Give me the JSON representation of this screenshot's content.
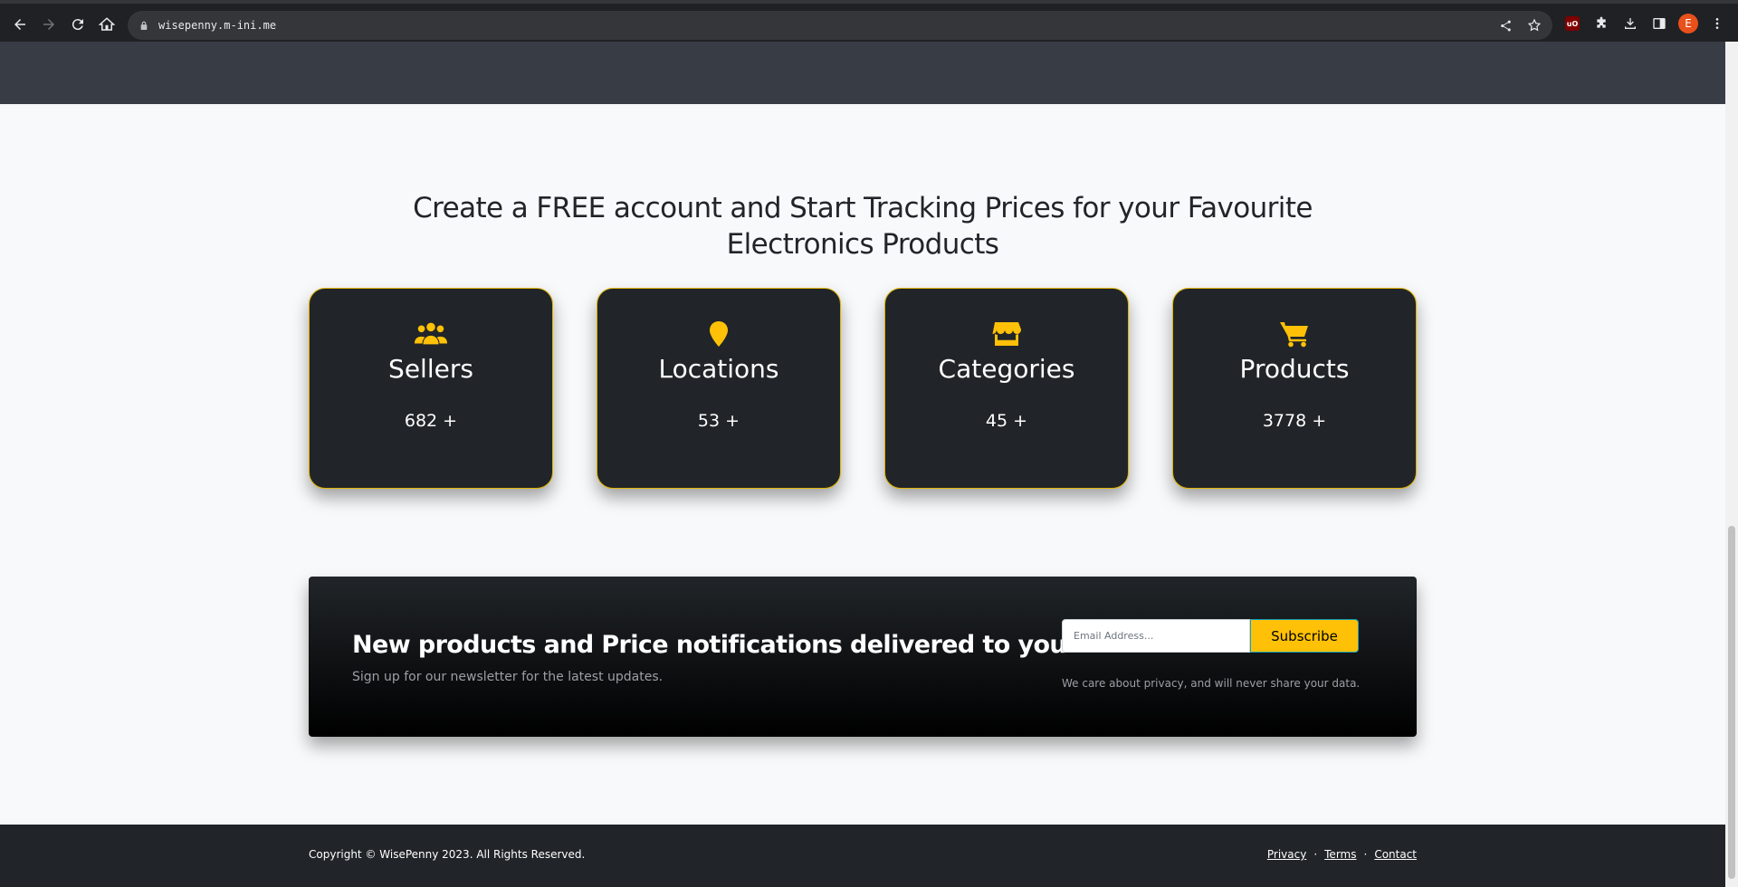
{
  "browser": {
    "url": "wisepenny.m-ini.me",
    "avatar_letter": "E",
    "ublock_label": "uO"
  },
  "hero": {
    "headline": "Create a FREE account and Start Tracking Prices for your Favourite Electronics Products"
  },
  "stats": [
    {
      "title": "Sellers",
      "count": "682 +",
      "icon": "users-icon"
    },
    {
      "title": "Locations",
      "count": "53 +",
      "icon": "map-pin-icon"
    },
    {
      "title": "Categories",
      "count": "45 +",
      "icon": "store-icon"
    },
    {
      "title": "Products",
      "count": "3778 +",
      "icon": "cart-icon"
    }
  ],
  "newsletter": {
    "title": "New products and Price notifications delivered to you.",
    "subtitle": "Sign up for our newsletter for the latest updates.",
    "email_placeholder": "Email Address...",
    "subscribe_label": "Subscribe",
    "privacy_note": "We care about privacy, and will never share your data."
  },
  "footer": {
    "copyright": "Copyright © WisePenny 2023. All Rights Reserved.",
    "links": [
      "Privacy",
      "Terms",
      "Contact"
    ],
    "separator": "·"
  },
  "colors": {
    "accent": "#ffc107",
    "card_bg": "#212529",
    "header_band": "#373c45"
  }
}
